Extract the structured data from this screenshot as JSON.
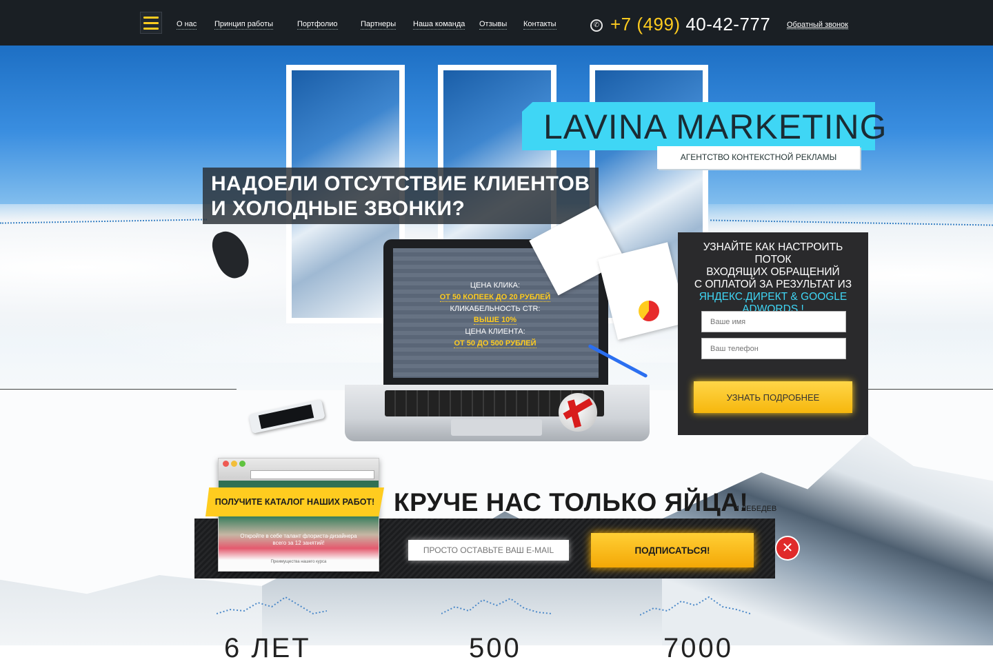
{
  "header": {
    "nav": [
      "О нас",
      "Принцип работы",
      "Портфолио",
      "Партнеры",
      "Наша команда",
      "Отзывы",
      "Контакты"
    ],
    "phone_code": "+7 (499)",
    "phone_number": "40-42-777",
    "callback": "Обратный звонок"
  },
  "brand": {
    "title": "LAVINA MARKETING",
    "subtitle": "АГЕНТСТВО КОНТЕКСТНОЙ РЕКЛАМЫ"
  },
  "hero": {
    "headline_line1": "НАДОЕЛИ ОТСУТСТВИЕ КЛИЕНТОВ",
    "headline_line2": "И ХОЛОДНЫЕ ЗВОНКИ?"
  },
  "screen": {
    "click_price_label": "ЦЕНА КЛИКА:",
    "click_price_value": "ОТ 50 КОПЕЕК ДО 20 РУБЛЕЙ",
    "ctr_label": "КЛИКАБЕЛЬНОСТЬ CTR:",
    "ctr_value": "ВЫШЕ 10%",
    "client_price_label": "ЦЕНА КЛИЕНТА:",
    "client_price_value": "ОТ 50 ДО 500 РУБЛЕЙ"
  },
  "form": {
    "title_1": "УЗНАЙТЕ КАК НАСТРОИТЬ ПОТОК",
    "title_2": "ВХОДЯЩИХ ОБРАЩЕНИЙ",
    "title_3": "С ОПЛАТОЙ ЗА РЕЗУЛЬТАТ ИЗ",
    "title_highlight": "ЯНДЕКС.ДИРЕКТ & GOOGLE ADWORDS !",
    "name_placeholder": "Ваше имя",
    "phone_placeholder": "Ваш телефон",
    "submit": "УЗНАТЬ ПОДРОБНЕЕ"
  },
  "subscribe": {
    "catalog": "ПОЛУЧИТЕ КАТАЛОГ НАШИХ РАБОТ!",
    "slogan": "КРУЧЕ НАС ТОЛЬКО ЯЙЦА!",
    "slogan_small": "И ЛЕБЕДЕВ",
    "email_placeholder": "ПРОСТО ОСТАВЬТЕ ВАШ E-MAIL",
    "button": "ПОДПИСАТЬСЯ!",
    "close": "✕",
    "browser_text": "Откройте в себе талант флориста-дизайнера всего за 12 занятий!",
    "browser_footer": "Преимущества нашего курса"
  },
  "stats": [
    "6 ЛЕТ",
    "500",
    "7000"
  ],
  "colors": {
    "accent_yellow": "#ffcc1f",
    "accent_cyan": "#3fd6f5",
    "header_bg": "#1a1f24"
  }
}
